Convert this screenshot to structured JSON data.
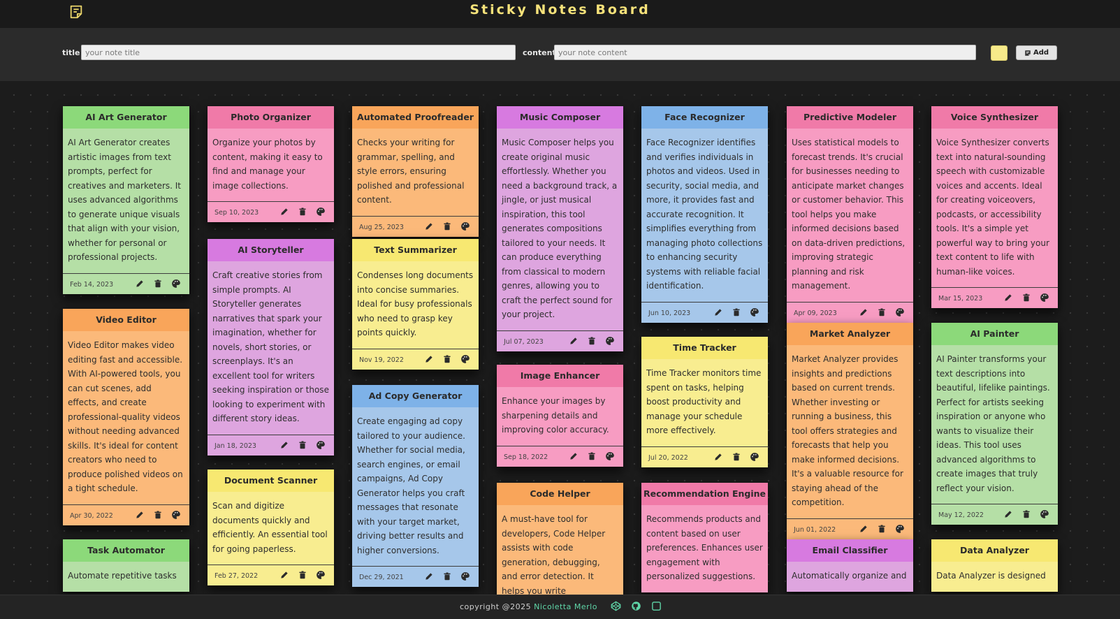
{
  "app": {
    "title": "Sticky Notes Board",
    "logo_icon": "sticky-note-icon"
  },
  "form": {
    "title_label": "title",
    "title_placeholder": "your note title",
    "content_label": "content",
    "content_placeholder": "your note content",
    "selected_color": "#f7ea8a",
    "add_label": "Add",
    "add_icon": "note-plus-icon"
  },
  "colors": {
    "green": {
      "head": "#8cd97a",
      "body": "#b5dfa6"
    },
    "pink": {
      "head": "#f07aa8",
      "body": "#f79cc2"
    },
    "orange": {
      "head": "#f9a55a",
      "body": "#fbb97a"
    },
    "purple": {
      "head": "#d77ae0",
      "body": "#dea5df"
    },
    "blue": {
      "head": "#7eb2e8",
      "body": "#a6c7ea"
    },
    "yellow": {
      "head": "#f7e871",
      "body": "#f8ed90"
    }
  },
  "columns": [
    [
      {
        "title": "AI Art Generator",
        "color": "green",
        "date": "Feb 14, 2023",
        "content": "AI Art Generator creates artistic images from text prompts, perfect for creatives and marketers. It uses advanced algorithms to generate unique visuals that align with your vision, whether for personal or professional projects."
      },
      {
        "title": "Video Editor",
        "color": "orange",
        "date": "Apr 30, 2022",
        "content": "Video Editor makes video editing fast and accessible. With AI-powered tools, you can cut scenes, add effects, and create professional-quality videos without needing advanced skills. It's ideal for content creators who need to produce polished videos on a tight schedule."
      },
      {
        "title": "Task Automator",
        "color": "green",
        "date": "",
        "content": "Automate repetitive tasks"
      }
    ],
    [
      {
        "title": "Photo Organizer",
        "color": "pink",
        "date": "Sep 10, 2023",
        "content": "Organize your photos by content, making it easy to find and manage your image collections."
      },
      {
        "title": "AI Storyteller",
        "color": "purple",
        "date": "Jan 18, 2023",
        "content": "Craft creative stories from simple prompts. AI Storyteller generates narratives that spark your imagination, whether for novels, short stories, or screenplays. It's an excellent tool for writers seeking inspiration or those looking to experiment with different story ideas."
      },
      {
        "title": "Document Scanner",
        "color": "yellow",
        "date": "Feb 27, 2022",
        "content": "Scan and digitize documents quickly and efficiently. An essential tool for going paperless."
      }
    ],
    [
      {
        "title": "Automated Proofreader",
        "color": "orange",
        "date": "Aug 25, 2023",
        "content": "Checks your writing for grammar, spelling, and style errors, ensuring polished and professional content."
      },
      {
        "title": "Text Summarizer",
        "color": "yellow",
        "date": "Nov 19, 2022",
        "content": "Condenses long documents into concise summaries. Ideal for busy professionals who need to grasp key points quickly."
      },
      {
        "title": "Ad Copy Generator",
        "color": "blue",
        "date": "Dec 29, 2021",
        "content": "Create engaging ad copy tailored to your audience. Whether for social media, search engines, or email campaigns, Ad Copy Generator helps you craft messages that resonate with your target market, driving better results and higher conversions."
      }
    ],
    [
      {
        "title": "Music Composer",
        "color": "purple",
        "date": "Jul 07, 2023",
        "content": "Music Composer helps you create original music effortlessly. Whether you need a background track, a jingle, or just musical inspiration, this tool generates compositions tailored to your needs. It can produce everything from classical to modern genres, allowing you to craft the perfect sound for your project."
      },
      {
        "title": "Image Enhancer",
        "color": "pink",
        "date": "Sep 18, 2022",
        "content": "Enhance your images by sharpening details and improving color accuracy."
      },
      {
        "title": "Code Helper",
        "color": "orange",
        "date": "",
        "content": "A must-have tool for developers, Code Helper assists with code generation, debugging, and error detection. It helps you write"
      }
    ],
    [
      {
        "title": "Face Recognizer",
        "color": "blue",
        "date": "Jun 10, 2023",
        "content": "Face Recognizer identifies and verifies individuals in photos and videos. Used in security, social media, and more, it provides fast and accurate recognition. It simplifies everything from managing photo collections to enhancing security systems with reliable facial identification."
      },
      {
        "title": "Time Tracker",
        "color": "yellow",
        "date": "Jul 20, 2022",
        "content": "Time Tracker monitors time spent on tasks, helping boost productivity and manage your schedule more effectively."
      },
      {
        "title": "Recommendation Engine",
        "color": "pink",
        "date": "",
        "content": "Recommends products and content based on user preferences. Enhances user engagement with personalized suggestions."
      }
    ],
    [
      {
        "title": "Predictive Modeler",
        "color": "pink",
        "date": "Apr 09, 2023",
        "content": "Uses statistical models to forecast trends. It's crucial for businesses needing to anticipate market changes or customer behavior. This tool helps you make informed decisions based on data-driven predictions, improving strategic planning and risk management."
      },
      {
        "title": "Market Analyzer",
        "color": "orange",
        "date": "Jun 01, 2022",
        "content": "Market Analyzer provides insights and predictions based on current trends. Whether investing or running a business, this tool offers strategies and forecasts that help you make informed decisions. It's a valuable resource for staying ahead of the competition."
      },
      {
        "title": "Email Classifier",
        "color": "purple",
        "date": "",
        "content": "Automatically organize and"
      }
    ],
    [
      {
        "title": "Voice Synthesizer",
        "color": "pink",
        "date": "Mar 15, 2023",
        "content": "Voice Synthesizer converts text into natural-sounding speech with customizable voices and accents. Ideal for creating voiceovers, podcasts, or accessibility tools. It's a simple yet powerful way to bring your text content to life with human-like voices."
      },
      {
        "title": "AI Painter",
        "color": "green",
        "date": "May 12, 2022",
        "content": "AI Painter transforms your text descriptions into beautiful, lifelike paintings. Perfect for artists seeking inspiration or anyone who wants to visualize their ideas. This tool uses advanced algorithms to create images that truly reflect your vision."
      },
      {
        "title": "Data Analyzer",
        "color": "yellow",
        "date": "",
        "content": "Data Analyzer is designed"
      }
    ]
  ],
  "note_actions": [
    "pencil-icon",
    "trash-icon",
    "palette-icon"
  ],
  "footer": {
    "copyright": "copyright @2025",
    "author": "Nicoletta Merlo",
    "icons": [
      "codepen-icon",
      "github-icon",
      "square-icon"
    ]
  }
}
